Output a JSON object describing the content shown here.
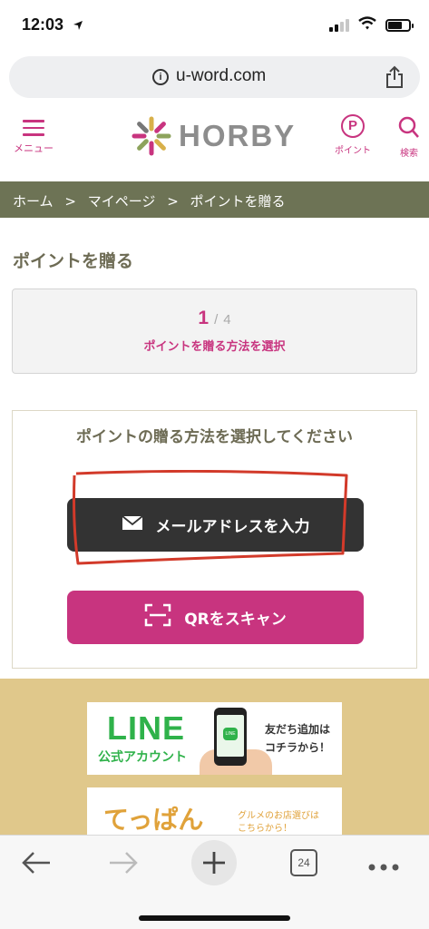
{
  "status_bar": {
    "time": "12:03"
  },
  "browser": {
    "url": "u-word.com",
    "tab_count": "24"
  },
  "site_header": {
    "logo_text": "HORBY",
    "menu_label": "メニュー",
    "point_label": "ポイント",
    "point_icon_letter": "P",
    "search_label": "検索"
  },
  "breadcrumb": [
    "ホーム",
    ">",
    "マイページ",
    ">",
    "ポイントを贈る"
  ],
  "page_title": "ポイントを贈る",
  "step": {
    "current": "1",
    "separator": "/",
    "total": "4",
    "label": "ポイントを贈る方法を選択"
  },
  "method": {
    "heading": "ポイントの贈る方法を選択してください",
    "email_button": "メールアドレスを入力",
    "qr_button": "QRをスキャン"
  },
  "banners": {
    "line": {
      "title": "LINE",
      "subtitle": "公式アカウント",
      "right_line1": "友だち追加は",
      "right_line2": "コチラから！",
      "phone_icon_text": "LINE"
    },
    "teppan": {
      "logo": "てっぱん",
      "sub_line1": "グルメのお店選びは",
      "sub_line2": "こちらから！"
    }
  },
  "colors": {
    "accent": "#c8347f",
    "breadcrumb_bg": "#6d7355",
    "banner_bg": "#e0c88b",
    "email_button": "#333333",
    "annotation": "#d23a2a"
  }
}
